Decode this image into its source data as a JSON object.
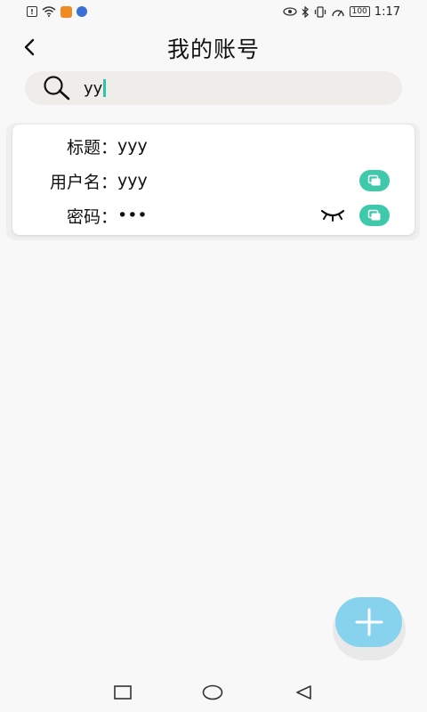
{
  "status_bar": {
    "time": "1:17",
    "battery": "100",
    "icons_left": [
      "notification-icon",
      "wifi-icon",
      "app-orange-icon",
      "app-blue-icon"
    ],
    "icons_right": [
      "eye-icon",
      "bluetooth-icon",
      "vibrate-icon",
      "speed-icon",
      "battery-icon"
    ]
  },
  "header": {
    "title": "我的账号",
    "back_icon": "chevron-left-icon"
  },
  "search": {
    "value": "yy",
    "icon": "search-icon"
  },
  "account": {
    "title_label": "标题：",
    "title_value": "yyy",
    "username_label": "用户名：",
    "username_value": "yyy",
    "password_label": "密码：",
    "password_value": "•••"
  },
  "fab": {
    "icon": "plus-icon"
  },
  "colors": {
    "accent": "#3ec9aa",
    "fab": "#87d2ec",
    "background": "#f8f8f8",
    "search_bg": "#eeedea"
  },
  "nav": {
    "icons": [
      "recent-apps-icon",
      "home-icon",
      "back-icon"
    ]
  }
}
